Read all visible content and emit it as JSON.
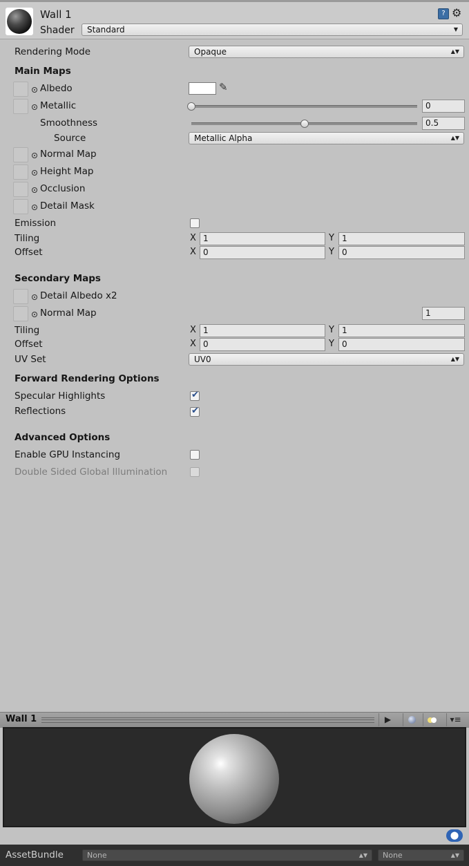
{
  "header": {
    "title": "Wall 1",
    "shader_label": "Shader",
    "shader_value": "Standard"
  },
  "rendering_mode": {
    "label": "Rendering Mode",
    "value": "Opaque"
  },
  "main_maps": {
    "title": "Main Maps",
    "albedo": "Albedo",
    "albedo_color": "#ffffff",
    "metallic": {
      "label": "Metallic",
      "value": "0",
      "fraction": 0.0
    },
    "smoothness": {
      "label": "Smoothness",
      "value": "0.5",
      "fraction": 0.5
    },
    "source": {
      "label": "Source",
      "value": "Metallic Alpha"
    },
    "normal_map": "Normal Map",
    "height_map": "Height Map",
    "occlusion": "Occlusion",
    "detail_mask": "Detail Mask",
    "emission": "Emission",
    "tiling": {
      "label": "Tiling",
      "x": "1",
      "y": "1"
    },
    "offset": {
      "label": "Offset",
      "x": "0",
      "y": "0"
    }
  },
  "axis": {
    "x": "X",
    "y": "Y"
  },
  "secondary_maps": {
    "title": "Secondary Maps",
    "detail_albedo": "Detail Albedo x2",
    "normal_map": "Normal Map",
    "normal_scale": "1",
    "tiling": {
      "label": "Tiling",
      "x": "1",
      "y": "1"
    },
    "offset": {
      "label": "Offset",
      "x": "0",
      "y": "0"
    },
    "uv_set": {
      "label": "UV Set",
      "value": "UV0"
    }
  },
  "forward_rendering": {
    "title": "Forward Rendering Options",
    "specular_highlights": "Specular Highlights",
    "reflections": "Reflections"
  },
  "advanced": {
    "title": "Advanced Options",
    "gpu_instancing": "Enable GPU Instancing",
    "double_sided_gi": "Double Sided Global Illumination"
  },
  "preview": {
    "title": "Wall 1"
  },
  "asset_bundle": {
    "label": "AssetBundle",
    "name_value": "None",
    "variant_value": "None"
  },
  "icons": {
    "help": "help-book-icon",
    "gear": "gear-icon",
    "eyedropper": "eyedropper-icon",
    "play": "play-icon",
    "sphere": "sphere-icon",
    "lights": "lights-icon",
    "menu": "menu-icon",
    "tag": "tag-icon"
  },
  "colors": {
    "panel_bg": "#c2c2c2",
    "preview_bg": "#2a2a2a",
    "check_accent": "#2a4f8c",
    "tag_blue": "#2f64b5"
  }
}
